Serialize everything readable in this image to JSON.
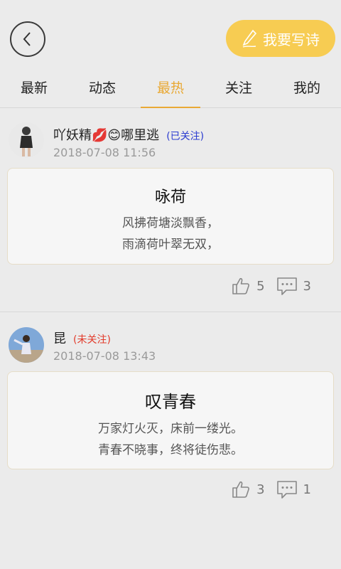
{
  "header": {
    "write_label": "我要写诗"
  },
  "tabs": [
    {
      "label": "最新",
      "active": false
    },
    {
      "label": "动态",
      "active": false
    },
    {
      "label": "最热",
      "active": true
    },
    {
      "label": "关注",
      "active": false
    },
    {
      "label": "我的",
      "active": false
    }
  ],
  "posts": [
    {
      "user": "吖妖精💋😊哪里逃",
      "follow": "(已关注)",
      "time": "2018-07-08 11:56",
      "title": "咏荷",
      "lines": [
        "风拂荷塘淡飘香，",
        "雨滴荷叶翠无双，"
      ],
      "likes": "5",
      "comments": "3"
    },
    {
      "user": "昆",
      "follow": "(未关注)",
      "time": "2018-07-08 13:43",
      "title": "叹青春",
      "lines": [
        "万家灯火灭，床前一缕光。",
        "青春不晓事，终将徒伤悲。"
      ],
      "likes": "3",
      "comments": "1"
    }
  ],
  "colors": {
    "accent": "#e9a935",
    "button": "#f7cc52",
    "followed": "#2a3bd0",
    "unfollowed": "#e23a2a"
  }
}
